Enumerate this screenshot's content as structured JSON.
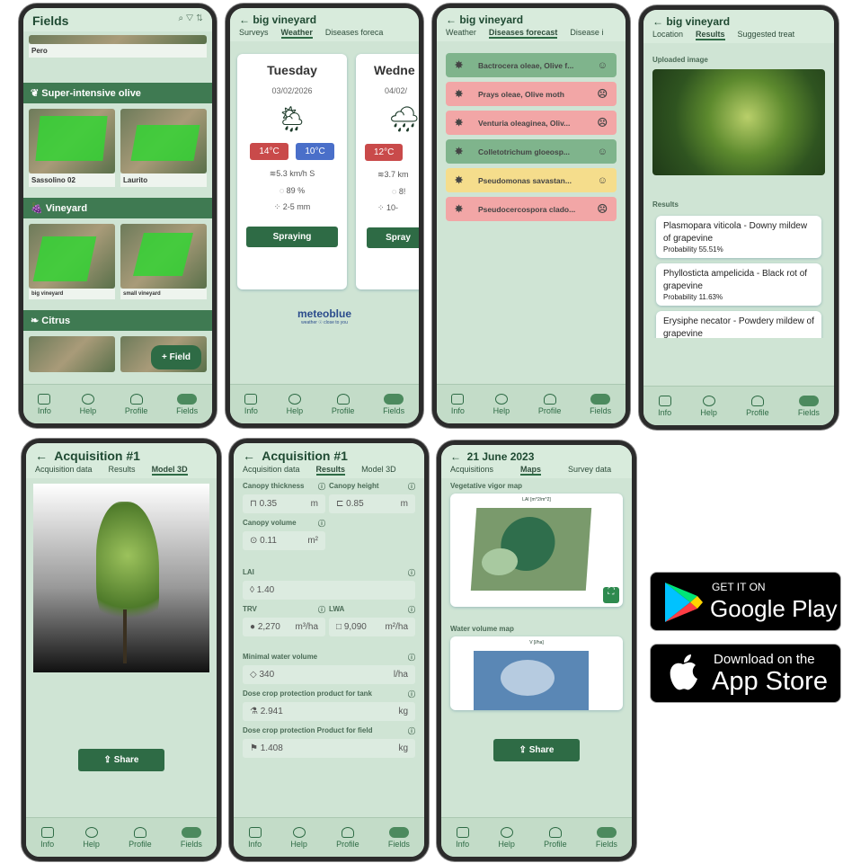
{
  "nav": {
    "info": "Info",
    "help": "Help",
    "profile": "Profile",
    "fields": "Fields"
  },
  "p1": {
    "title": "Fields",
    "first_caption": "Pero",
    "sections": [
      {
        "label": "Super-intensive olive",
        "items": [
          "Sassolino 02",
          "Laurito"
        ]
      },
      {
        "label": "Vineyard",
        "items": [
          "big vineyard",
          "small vineyard"
        ]
      },
      {
        "label": "Citrus",
        "items": []
      }
    ],
    "fab": "+ Field"
  },
  "p2": {
    "title": "big vineyard",
    "tabs": [
      "Surveys",
      "Weather",
      "Diseases foreca"
    ],
    "day1": {
      "day": "Tuesday",
      "date": "03/02/2026",
      "tmax": "14°C",
      "tmin": "10°C",
      "wind": "5.3 km/h S",
      "hum": "89 %",
      "rain": "2-5 mm",
      "button": "Spraying"
    },
    "day2": {
      "day": "Wedne",
      "date": "04/02/",
      "tmax": "12°C",
      "wind": "3.7 km",
      "hum": "8!",
      "rain": "10-",
      "button": "Spray"
    },
    "brand": "meteoblue",
    "brand_sub": "weather ☉ close to you"
  },
  "p3": {
    "title": "big vineyard",
    "tabs": [
      "Weather",
      "Diseases forecast",
      "Disease i"
    ],
    "items": [
      {
        "label": "Bactrocera oleae, Olive f...",
        "status": "green"
      },
      {
        "label": "Prays oleae, Olive moth",
        "status": "red"
      },
      {
        "label": "Venturia oleaginea, Oliv...",
        "status": "red"
      },
      {
        "label": "Colletotrichum gloeosp...",
        "status": "green"
      },
      {
        "label": "Pseudomonas savastan...",
        "status": "yellow"
      },
      {
        "label": "Pseudocercospora clado...",
        "status": "red"
      }
    ]
  },
  "p4": {
    "title": "big vineyard",
    "tabs": [
      "Location",
      "Results",
      "Suggested treat"
    ],
    "uploaded": "Uploaded image",
    "results_label": "Results",
    "results": [
      {
        "name": "Plasmopara viticola - Downy mildew of grapevine",
        "prob": "Probability 55.51%"
      },
      {
        "name": "Phyllosticta ampelicida - Black rot of grapevine",
        "prob": "Probability 11.63%"
      },
      {
        "name": "Erysiphe necator - Powdery mildew of grapevine",
        "prob": ""
      }
    ]
  },
  "p5": {
    "title": "Acquisition #1",
    "tabs": [
      "Acquisition data",
      "Results",
      "Model 3D"
    ],
    "share": "Share"
  },
  "p6": {
    "title": "Acquisition #1",
    "tabs": [
      "Acquisition data",
      "Results",
      "Model 3D"
    ],
    "canopy_thickness": "Canopy thickness",
    "ct_val": "0.35",
    "ct_unit": "m",
    "canopy_height": "Canopy height",
    "ch_val": "0.85",
    "ch_unit": "m",
    "canopy_volume": "Canopy volume",
    "cv_val": "0.11",
    "cv_unit": "m²",
    "lai": "LAI",
    "lai_val": "1.40",
    "trv": "TRV",
    "trv_val": "2,270",
    "trv_unit": "m³/ha",
    "lwa": "LWA",
    "lwa_val": "9,090",
    "lwa_unit": "m²/ha",
    "mwv": "Minimal water volume",
    "mwv_val": "340",
    "mwv_unit": "l/ha",
    "dose_tank": "Dose crop protection product for tank",
    "dt_val": "2.941",
    "dt_unit": "kg",
    "dose_field": "Dose crop protection Product for field",
    "df_val": "1.408",
    "df_unit": "kg"
  },
  "p7": {
    "title": "21 June 2023",
    "tabs": [
      "Acquisitions",
      "Maps",
      "Survey data"
    ],
    "map1": "Vegetative vigor map",
    "map1_title": "LAI [m^2/m^2]",
    "map2": "Water volume map",
    "map2_title": "V [l/ha]",
    "share": "Share"
  },
  "stores": {
    "gp_top": "GET IT ON",
    "gp_main": "Google Play",
    "as_top": "Download on the",
    "as_main": "App Store"
  },
  "colors": {
    "green": "#5f9c6e",
    "red": "#f2a6a6",
    "yellow": "#f5dd8c",
    "accent": "#2e6b45"
  }
}
